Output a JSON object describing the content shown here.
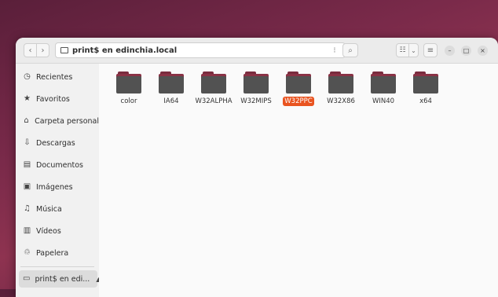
{
  "headerbar": {
    "path": "print$ en edinchia.local",
    "back_symbol": "‹",
    "forward_symbol": "›",
    "path_more_symbol": "⁝",
    "search_symbol": "⌕",
    "view_symbol": "☷",
    "view_dropdown_symbol": "⌄",
    "menu_symbol": "≡",
    "minimize_symbol": "–",
    "maximize_symbol": "□",
    "close_symbol": "×"
  },
  "sidebar": {
    "items": [
      {
        "label": "Recientes",
        "icon": "clock-icon",
        "glyph": "◷"
      },
      {
        "label": "Favoritos",
        "icon": "star-icon",
        "glyph": "★"
      },
      {
        "label": "Carpeta personal",
        "icon": "home-icon",
        "glyph": "⌂"
      },
      {
        "label": "Descargas",
        "icon": "download-icon",
        "glyph": "⇩"
      },
      {
        "label": "Documentos",
        "icon": "document-icon",
        "glyph": "▤"
      },
      {
        "label": "Imágenes",
        "icon": "image-icon",
        "glyph": "▣"
      },
      {
        "label": "Música",
        "icon": "music-icon",
        "glyph": "♫"
      },
      {
        "label": "Vídeos",
        "icon": "video-icon",
        "glyph": "▥"
      },
      {
        "label": "Papelera",
        "icon": "trash-icon",
        "glyph": "♲"
      }
    ],
    "network": {
      "label": "print$ en edi...",
      "icon": "network-share-icon",
      "glyph": "▭",
      "eject": "▲"
    }
  },
  "content": {
    "folders": [
      "color",
      "IA64",
      "W32ALPHA",
      "W32MIPS",
      "W32PPC",
      "W32X86",
      "WIN40",
      "x64"
    ],
    "selected": "W32PPC",
    "accent": "#e95420"
  }
}
